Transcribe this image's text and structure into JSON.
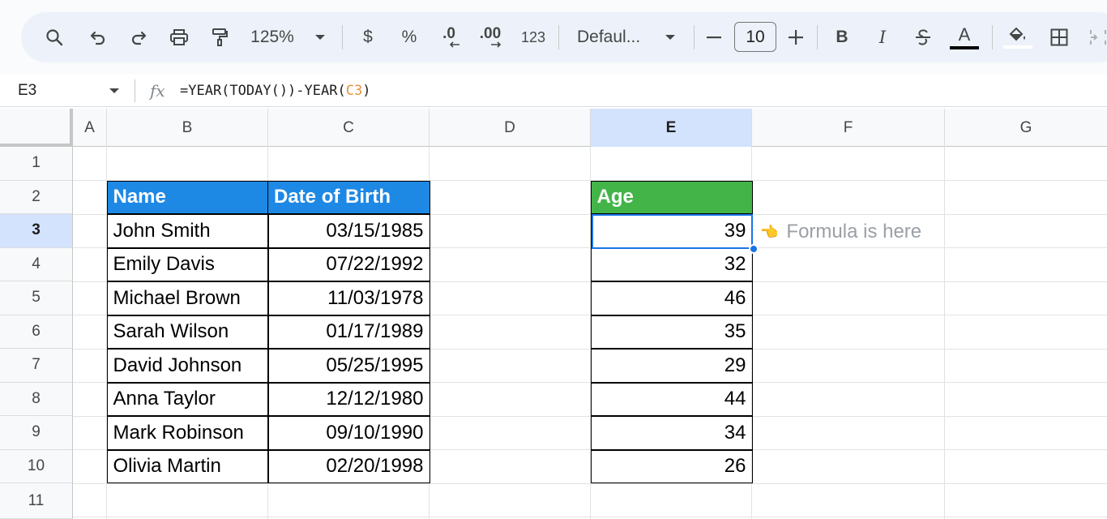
{
  "toolbar": {
    "zoom": "125%",
    "currency_label": "$",
    "percent_label": "%",
    "decrease_decimal_label": ".0",
    "increase_decimal_label": ".00",
    "number_format_label": "123",
    "font_name": "Defaul...",
    "font_size": "10",
    "bold_label": "B",
    "italic_label": "I",
    "text_color_label": "A",
    "icons": [
      "search-icon",
      "undo-icon",
      "redo-icon",
      "print-icon",
      "paint-format-icon",
      "chevron-down-icon",
      "minus-icon",
      "plus-icon",
      "strikethrough-icon",
      "fill-color-icon",
      "borders-icon",
      "merge-cells-icon"
    ]
  },
  "formula_bar": {
    "name_box": "E3",
    "fx_label": "fx",
    "formula_prefix": "=YEAR(TODAY())-YEAR(",
    "formula_ref": "C3",
    "formula_suffix": ")"
  },
  "columns": [
    "A",
    "B",
    "C",
    "D",
    "E",
    "F",
    "G"
  ],
  "selected_column": "E",
  "rows": [
    "1",
    "2",
    "3",
    "4",
    "5",
    "6",
    "7",
    "8",
    "9",
    "10",
    "11"
  ],
  "selected_row": "3",
  "table": {
    "headers": {
      "name": "Name",
      "dob": "Date of Birth",
      "age": "Age"
    },
    "records": [
      {
        "name": "John Smith",
        "dob": "03/15/1985",
        "age": "39"
      },
      {
        "name": "Emily Davis",
        "dob": "07/22/1992",
        "age": "32"
      },
      {
        "name": "Michael Brown",
        "dob": "11/03/1978",
        "age": "46"
      },
      {
        "name": "Sarah Wilson",
        "dob": "01/17/1989",
        "age": "35"
      },
      {
        "name": "David Johnson",
        "dob": "05/25/1995",
        "age": "29"
      },
      {
        "name": "Anna Taylor",
        "dob": "12/12/1980",
        "age": "44"
      },
      {
        "name": "Mark Robinson",
        "dob": "09/10/1990",
        "age": "34"
      },
      {
        "name": "Olivia Martin",
        "dob": "02/20/1998",
        "age": "26"
      }
    ]
  },
  "note": {
    "hand": "👈",
    "text": "Formula is here"
  },
  "colors": {
    "name_header": "#1e88e5",
    "age_header": "#43b548",
    "selection": "#1a73e8",
    "formula_ref": "#e69138"
  }
}
